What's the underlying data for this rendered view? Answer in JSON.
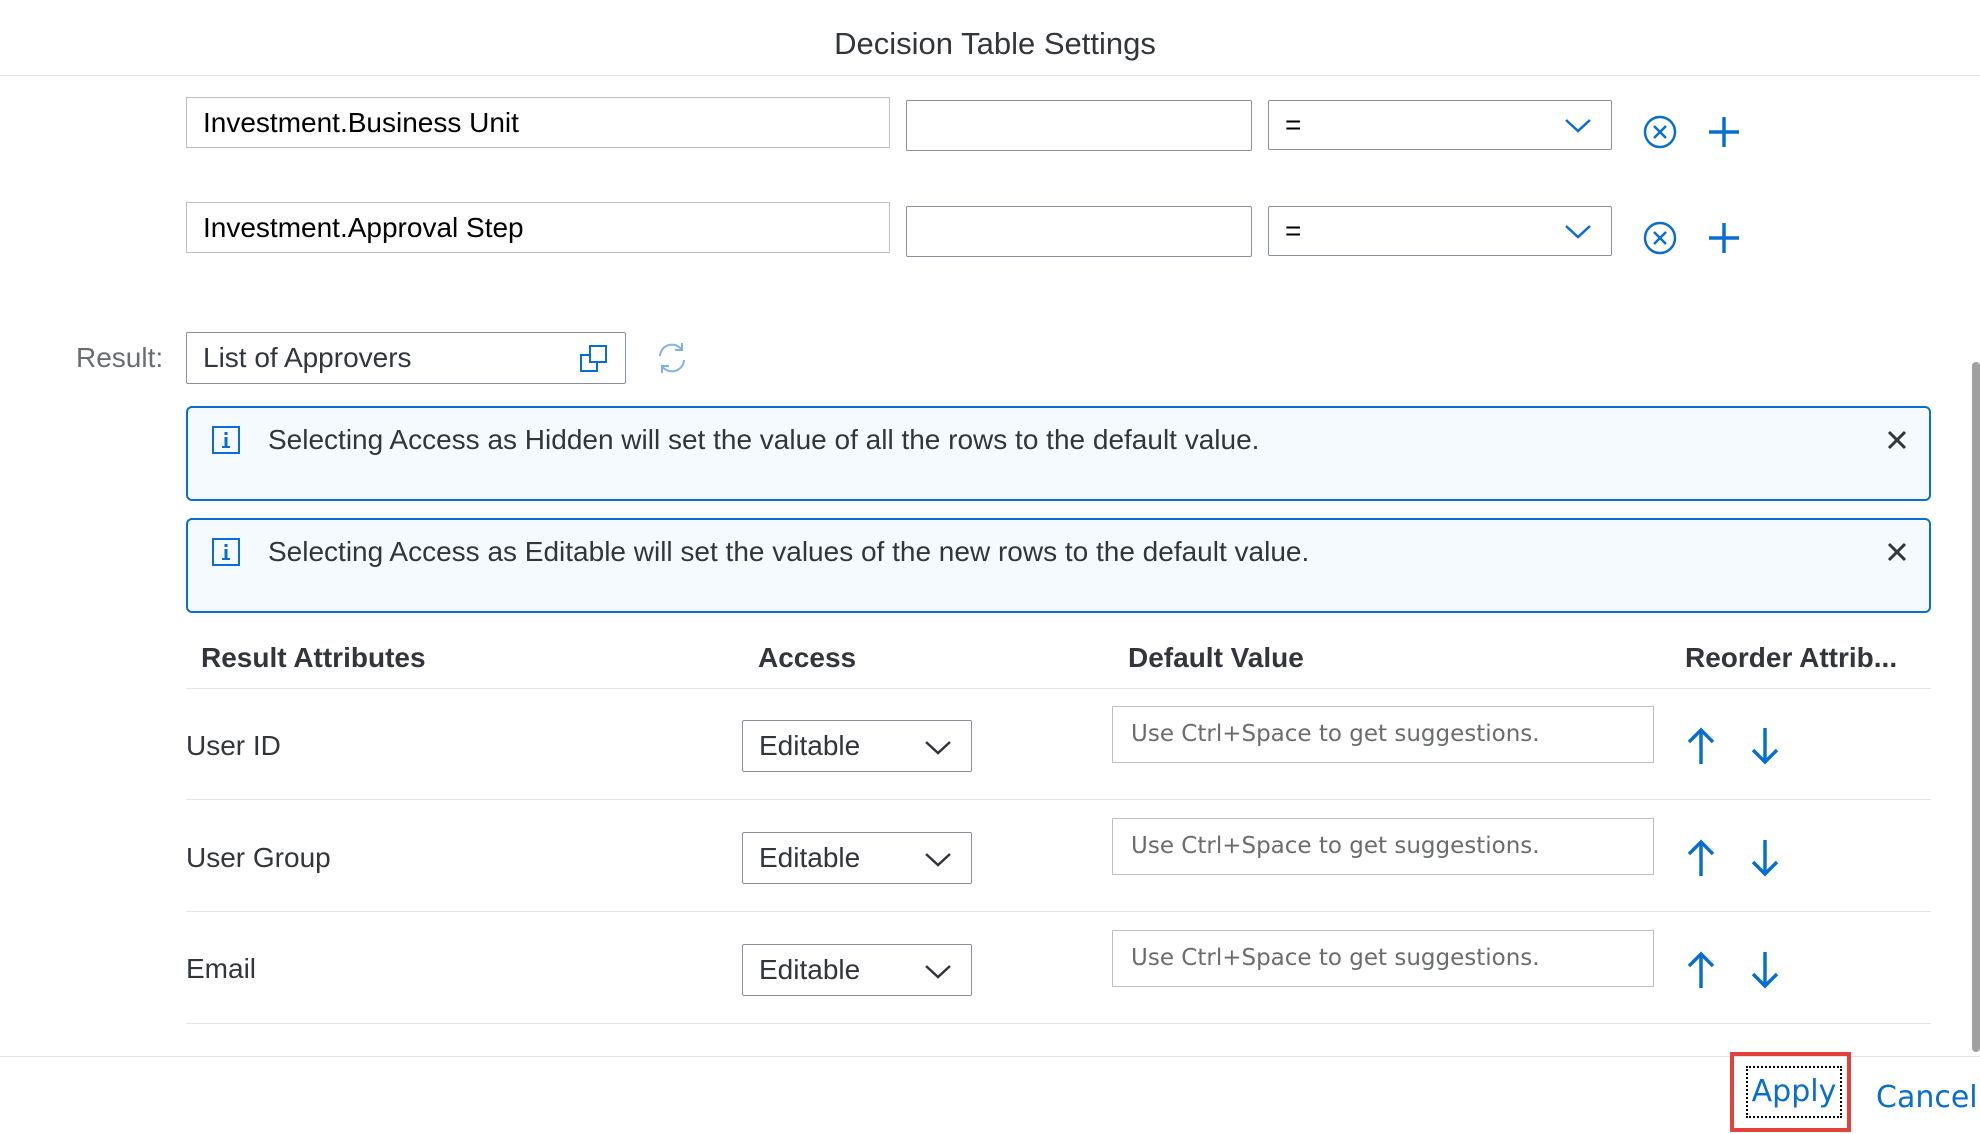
{
  "dialog": {
    "title": "Decision Table Settings"
  },
  "conditions": [
    {
      "attribute": "Investment.Business Unit",
      "value": "",
      "operator": "="
    },
    {
      "attribute": "Investment.Approval Step",
      "value": "",
      "operator": "="
    }
  ],
  "result": {
    "label": "Result:",
    "value": "List of Approvers"
  },
  "messages": [
    {
      "text": "Selecting Access as Hidden will set the value of all the rows to the default value."
    },
    {
      "text": "Selecting Access as Editable will set the values of the new rows to the default value."
    }
  ],
  "table": {
    "columns": [
      "Result Attributes",
      "Access",
      "Default Value",
      "Reorder Attrib..."
    ],
    "rows": [
      {
        "attribute": "User ID",
        "access": "Editable",
        "default_placeholder": "Use Ctrl+Space to get suggestions."
      },
      {
        "attribute": "User Group",
        "access": "Editable",
        "default_placeholder": "Use Ctrl+Space to get suggestions."
      },
      {
        "attribute": "Email",
        "access": "Editable",
        "default_placeholder": "Use Ctrl+Space to get suggestions."
      }
    ]
  },
  "footer": {
    "apply_label": "Apply",
    "cancel_label": "Cancel"
  },
  "colors": {
    "accent": "#0a6ed1",
    "highlight": "#e2423b",
    "info_background": "#f5faff"
  },
  "icons": {
    "remove": "remove-circle-icon",
    "add": "add-icon",
    "value_help": "value-help-icon",
    "refresh": "refresh-icon",
    "info": "info-icon",
    "close": "close-icon",
    "move_up": "arrow-up-icon",
    "move_down": "arrow-down-icon",
    "dropdown": "chevron-down-icon"
  }
}
